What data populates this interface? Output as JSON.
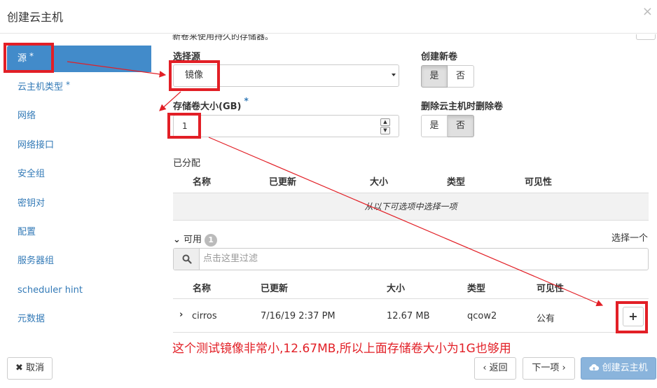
{
  "window": {
    "title": "创建云主机",
    "close_symbol": "×"
  },
  "sidebar": {
    "items": [
      {
        "label": "源",
        "required": true,
        "active": true
      },
      {
        "label": "云主机类型",
        "required": true
      },
      {
        "label": "网络"
      },
      {
        "label": "网络接口"
      },
      {
        "label": "安全组"
      },
      {
        "label": "密钥对"
      },
      {
        "label": "配置"
      },
      {
        "label": "服务器组"
      },
      {
        "label": "scheduler hint"
      },
      {
        "label": "元数据"
      }
    ],
    "required_mark": "*"
  },
  "form": {
    "cut_help_text": "新卷来使用持久的存储器。",
    "boot_source": {
      "label": "选择源",
      "value": "镜像"
    },
    "create_volume": {
      "label": "创建新卷",
      "yes": "是",
      "no": "否",
      "selected": "是"
    },
    "volume_size": {
      "label": "存储卷大小(GB)",
      "required_mark": "*",
      "value": "1"
    },
    "delete_on_terminate": {
      "label": "删除云主机时删除卷",
      "yes": "是",
      "no": "否",
      "selected": "否"
    }
  },
  "allocated": {
    "title": "已分配",
    "columns": [
      "名称",
      "已更新",
      "大小",
      "类型",
      "可见性"
    ],
    "empty_message": "从以下可选项中选择一项"
  },
  "available": {
    "title": "可用",
    "count": "1",
    "select_hint": "选择一个",
    "filter_placeholder": "点击这里过滤",
    "columns": [
      "名称",
      "已更新",
      "大小",
      "类型",
      "可见性"
    ],
    "rows": [
      {
        "name": "cirros",
        "updated": "7/16/19 2:37 PM",
        "size": "12.67 MB",
        "type": "qcow2",
        "visibility": "公有",
        "add": "+"
      }
    ]
  },
  "annotation": "这个测试镜像非常小,12.67MB,所以上面存储卷大小为1G也够用",
  "footer": {
    "cancel": "✖ 取消",
    "back": "‹ 返回",
    "next": "下一项 ›",
    "create": "创建云主机"
  },
  "colors": {
    "accent": "#428bca",
    "annotation_red": "#e21f26",
    "primary_disabled": "#8ab4dc"
  }
}
